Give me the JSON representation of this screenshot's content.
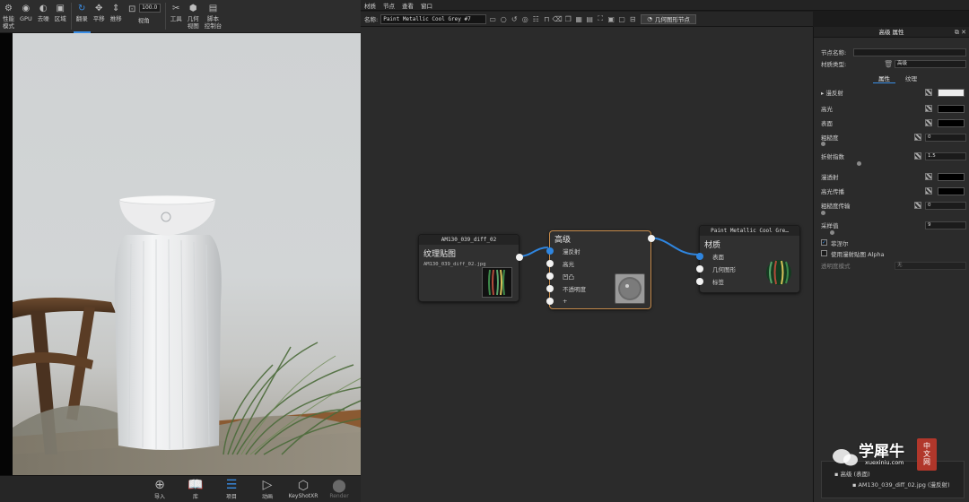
{
  "viewport_toolbar": {
    "items": [
      {
        "label": "性能\n模式",
        "icon": "performance-icon"
      },
      {
        "label": "GPU",
        "icon": "gpu-icon"
      },
      {
        "label": "去噪",
        "icon": "denoise-icon"
      },
      {
        "label": "区域",
        "icon": "region-icon"
      },
      {
        "label": "翻录",
        "icon": "refresh-icon"
      },
      {
        "label": "平移",
        "icon": "pan-icon"
      },
      {
        "label": "推移",
        "icon": "dolly-icon"
      },
      {
        "label": "视角",
        "icon": "fov-icon"
      },
      {
        "label": "工具",
        "icon": "tools-icon"
      },
      {
        "label": "几何\n视图",
        "icon": "geometry-view-icon"
      },
      {
        "label": "脚本\n控制台",
        "icon": "script-console-icon"
      }
    ],
    "fov_value": "100.0"
  },
  "viewport_bottom": {
    "items": [
      {
        "label": "导入",
        "icon": "import-icon"
      },
      {
        "label": "库",
        "icon": "library-icon"
      },
      {
        "label": "项目",
        "icon": "project-icon"
      },
      {
        "label": "动画",
        "icon": "animation-icon"
      },
      {
        "label": "KeyShotXR",
        "icon": "keyshotxr-icon"
      },
      {
        "label": "Render",
        "icon": "render-icon"
      }
    ]
  },
  "menubar": {
    "items": [
      "材质",
      "节点",
      "查看",
      "窗口"
    ]
  },
  "graph_toolbar": {
    "name_label": "名称:",
    "name_value": "Paint Metallic Cool Grey #7",
    "geometry_button": "几何图形节点"
  },
  "nodes": {
    "texture": {
      "header": "AM130_039_diff_02",
      "title": "纹理贴图",
      "filename": "AM130_039_diff_02.jpg"
    },
    "advanced": {
      "title": "高级",
      "ports": [
        "漫反射",
        "高光",
        "凹凸",
        "不透明度",
        "+"
      ]
    },
    "material": {
      "header": "Paint Metallic Cool Gre…",
      "title": "材质",
      "ports": [
        "表面",
        "几何图形",
        "标签"
      ]
    }
  },
  "properties": {
    "title": "高级 属性",
    "node_name_label": "节点名称:",
    "material_type_label": "材质类型:",
    "material_type_value": "高级",
    "tabs": [
      "属性",
      "纹理"
    ],
    "rows": {
      "diffuse": "漫反射",
      "specular": "高光",
      "bump": "表面",
      "roughness": "粗糙度",
      "roughness_value": "0",
      "ior": "折射指数",
      "ior_value": "1.5",
      "translucency": "漫透射",
      "specular_transmission": "高光传播",
      "roughness_transmission": "粗糙度传输",
      "roughness_transmission_value": "0",
      "samples": "采样值",
      "samples_value": "9",
      "fresnel": "菲涅尔",
      "use_diffuse_alpha": "使用漫射贴图 Alpha",
      "transparency_mode": "透明度模式",
      "transparency_mode_value": "无"
    },
    "tree": {
      "row1": "高级 (表面)",
      "row2": "AM130_039_diff_02.jpg (漫反射)"
    },
    "colors": {
      "diffuse": "#eeeeee",
      "specular": "#000000",
      "bump": "#000000",
      "translucency": "#000000",
      "specular_transmission": "#000000"
    }
  },
  "watermark": {
    "text": "学犀牛",
    "sub": "xuexiniu.com",
    "badge": "中文网"
  }
}
